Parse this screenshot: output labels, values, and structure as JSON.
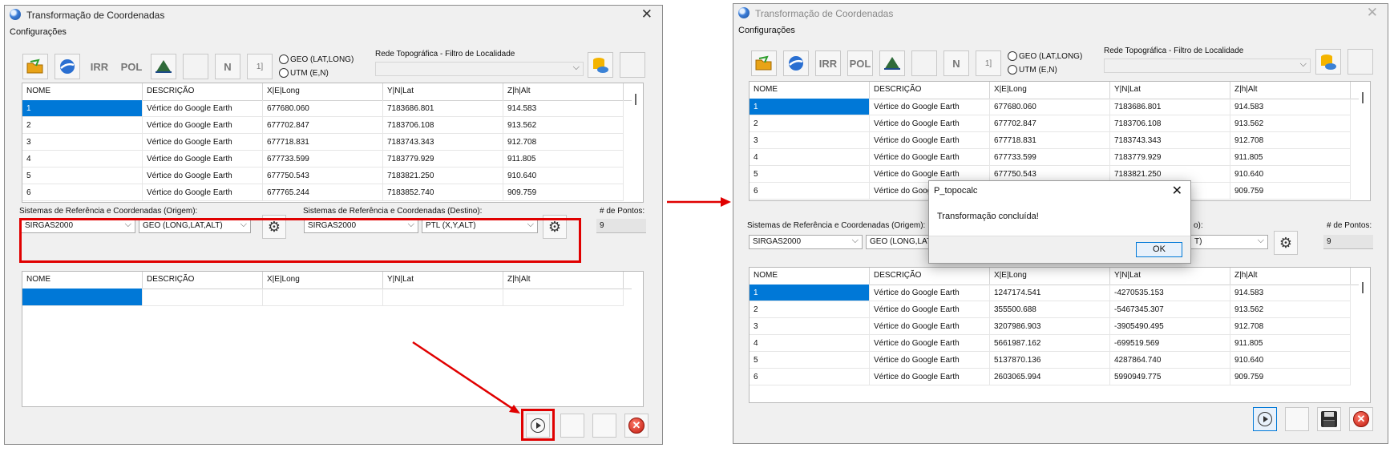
{
  "title": "Transformação de Coordenadas",
  "menu": "Configurações",
  "toolbar": {
    "irr": "IRR",
    "pol": "POL",
    "n": "N",
    "bracket": "1]"
  },
  "radio": {
    "geo": "GEO (LAT,LONG)",
    "utm": "UTM (E,N)"
  },
  "rede_label": "Rede Topográfica - Filtro de Localidade",
  "columns": [
    "NOME",
    "DESCRIÇÃO",
    "X|E|Long",
    "Y|N|Lat",
    "Z|h|Alt"
  ],
  "origin_rows": [
    [
      "1",
      "Vértice do Google Earth",
      "677680.060",
      "7183686.801",
      "914.583"
    ],
    [
      "2",
      "Vértice do Google Earth",
      "677702.847",
      "7183706.108",
      "913.562"
    ],
    [
      "3",
      "Vértice do Google Earth",
      "677718.831",
      "7183743.343",
      "912.708"
    ],
    [
      "4",
      "Vértice do Google Earth",
      "677733.599",
      "7183779.929",
      "911.805"
    ],
    [
      "5",
      "Vértice do Google Earth",
      "677750.543",
      "7183821.250",
      "910.640"
    ],
    [
      "6",
      "Vértice do Google Earth",
      "677765.244",
      "7183852.740",
      "909.759"
    ]
  ],
  "left_origin_rows": [
    [
      "1",
      "Vértice do Google Earth",
      "677680.060",
      "7183686.801",
      "914.583"
    ],
    [
      "2",
      "Vértice do Google Earth",
      "677702.847",
      "7183706.108",
      "913.562"
    ],
    [
      "3",
      "Vértice do Google Earth",
      "677718.831",
      "7183743.343",
      "912.708"
    ],
    [
      "4",
      "Vértice do Google Earth",
      "677733.599",
      "7183779.929",
      "911.805"
    ],
    [
      "5",
      "Vértice do Google Earth",
      "677750.543",
      "7183821.250",
      "910.640"
    ],
    [
      "6",
      "Vértice do Google Earth",
      "677765.244",
      "7183852.740",
      "909.759"
    ]
  ],
  "right_origin_rows": [
    [
      "1",
      "Vértice do Google Earth",
      "677680.060",
      "7183686.801",
      "914.583"
    ],
    [
      "2",
      "Vértice do Google Earth",
      "677702.847",
      "7183706.108",
      "913.562"
    ],
    [
      "3",
      "Vértice do Google Earth",
      "677718.831",
      "7183743.343",
      "912.708"
    ],
    [
      "4",
      "Vértice do Google Earth",
      "677733.599",
      "7183779.929",
      "911.805"
    ],
    [
      "5",
      "Vértice do Google Earth",
      "677750.543",
      "7183821.250",
      "910.640"
    ],
    [
      "6",
      "Vértice do Google",
      "",
      "",
      "909.759"
    ]
  ],
  "result_rows": [
    [
      "1",
      "Vértice do Google Earth",
      "1247174.541",
      "-4270535.153",
      "914.583"
    ],
    [
      "2",
      "Vértice do Google Earth",
      "355500.688",
      "-5467345.307",
      "913.562"
    ],
    [
      "3",
      "Vértice do Google Earth",
      "3207986.903",
      "-3905490.495",
      "912.708"
    ],
    [
      "4",
      "Vértice do Google Earth",
      "5661987.162",
      "-699519.569",
      "911.805"
    ],
    [
      "5",
      "Vértice do Google Earth",
      "5137870.136",
      "4287864.740",
      "910.640"
    ],
    [
      "6",
      "Vértice do Google Earth",
      "2603065.994",
      "5990949.775",
      "909.759"
    ]
  ],
  "srs": {
    "origin_label": "Sistemas de Referência e Coordenadas (Origem):",
    "dest_label": "Sistemas de Referência e Coordenadas (Destino):",
    "dest_label_partial": "o):",
    "origin_datum": "SIRGAS2000",
    "origin_type": "GEO (LONG,LAT,ALT)",
    "origin_type_partial": "GEO (LONG,LAT,",
    "dest_datum": "SIRGAS2000",
    "dest_type": "PTL (X,Y,ALT)",
    "dest_type_partial": "T)",
    "points_label": "# de Pontos:",
    "points_value": "9"
  },
  "dialog": {
    "title": "P_topocalc",
    "message": "Transformação concluída!",
    "ok": "OK"
  },
  "colors": {
    "selection": "#0078d7",
    "highlight": "#e00000"
  }
}
